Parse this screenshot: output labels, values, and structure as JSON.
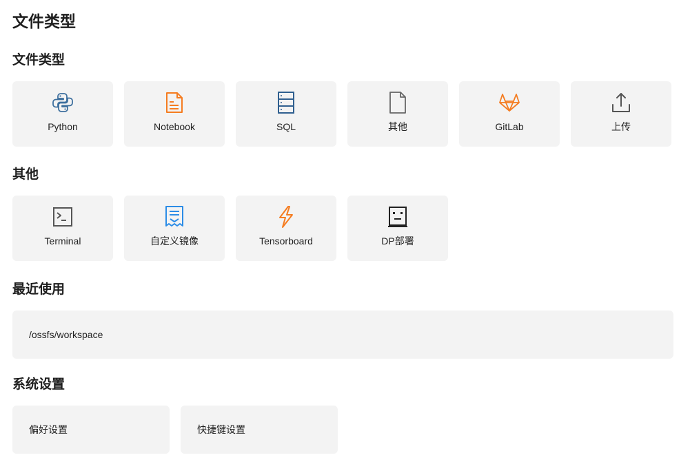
{
  "page_title": "文件类型",
  "sections": {
    "file_types": {
      "title": "文件类型",
      "items": [
        {
          "label": "Python",
          "icon": "python-icon"
        },
        {
          "label": "Notebook",
          "icon": "notebook-icon"
        },
        {
          "label": "SQL",
          "icon": "database-icon"
        },
        {
          "label": "其他",
          "icon": "file-icon"
        },
        {
          "label": "GitLab",
          "icon": "gitlab-icon"
        },
        {
          "label": "上传",
          "icon": "upload-icon"
        }
      ]
    },
    "other": {
      "title": "其他",
      "items": [
        {
          "label": "Terminal",
          "icon": "terminal-icon"
        },
        {
          "label": "自定义镜像",
          "icon": "custom-image-icon"
        },
        {
          "label": "Tensorboard",
          "icon": "tensorboard-icon"
        },
        {
          "label": "DP部署",
          "icon": "robot-face-icon"
        }
      ]
    },
    "recent": {
      "title": "最近使用",
      "items": [
        {
          "label": "/ossfs/workspace"
        }
      ]
    },
    "settings": {
      "title": "系统设置",
      "items": [
        {
          "label": "偏好设置"
        },
        {
          "label": "快捷键设置"
        }
      ]
    }
  },
  "colors": {
    "card_bg": "#f3f3f3",
    "python_blue": "#3d6f9e",
    "orange": "#f57c20",
    "sql_blue": "#2f5f8f",
    "gray_icon": "#666666",
    "custom_blue": "#2b8ce6"
  }
}
